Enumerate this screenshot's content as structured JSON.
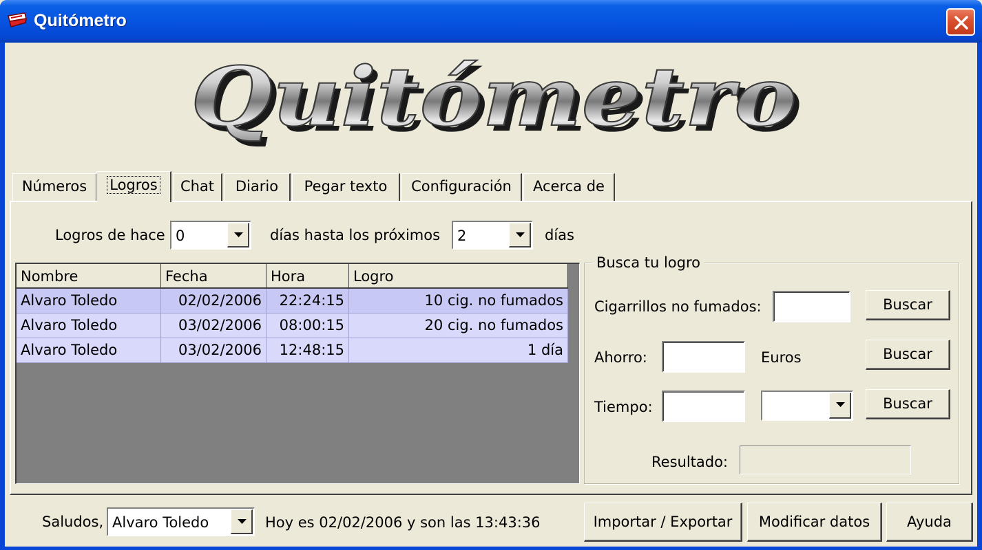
{
  "window": {
    "title": "Quitómetro"
  },
  "logo": {
    "text": "Quitómetro"
  },
  "tabs": [
    {
      "label": "Números"
    },
    {
      "label": "Logros"
    },
    {
      "label": "Chat"
    },
    {
      "label": "Diario"
    },
    {
      "label": "Pegar texto"
    },
    {
      "label": "Configuración"
    },
    {
      "label": "Acerca de"
    }
  ],
  "logros": {
    "prefix_label": "Logros de hace",
    "from_days": "0",
    "middle_label": "días hasta los próximos",
    "to_days": "2",
    "suffix_label": "días"
  },
  "grid": {
    "columns": [
      "Nombre",
      "Fecha",
      "Hora",
      "Logro"
    ],
    "rows": [
      [
        "Alvaro Toledo",
        "02/02/2006",
        "22:24:15",
        "10 cig. no fumados"
      ],
      [
        "Alvaro Toledo",
        "03/02/2006",
        "08:00:15",
        "20 cig. no fumados"
      ],
      [
        "Alvaro Toledo",
        "03/02/2006",
        "12:48:15",
        "1 día"
      ]
    ]
  },
  "search": {
    "title": "Busca tu logro",
    "cigarettes_label": "Cigarrillos no fumados:",
    "cigarettes_value": "",
    "savings_label": "Ahorro:",
    "savings_value": "",
    "savings_unit": "Euros",
    "time_label": "Tiempo:",
    "time_value": "",
    "time_unit_value": "",
    "search_button": "Buscar",
    "result_label": "Resultado:",
    "result_value": ""
  },
  "footer": {
    "greeting_label": "Saludos,",
    "user": "Alvaro Toledo",
    "status": "Hoy es 02/02/2006 y son las 13:43:36",
    "import_export": "Importar / Exportar",
    "modify": "Modificar datos",
    "help": "Ayuda"
  }
}
